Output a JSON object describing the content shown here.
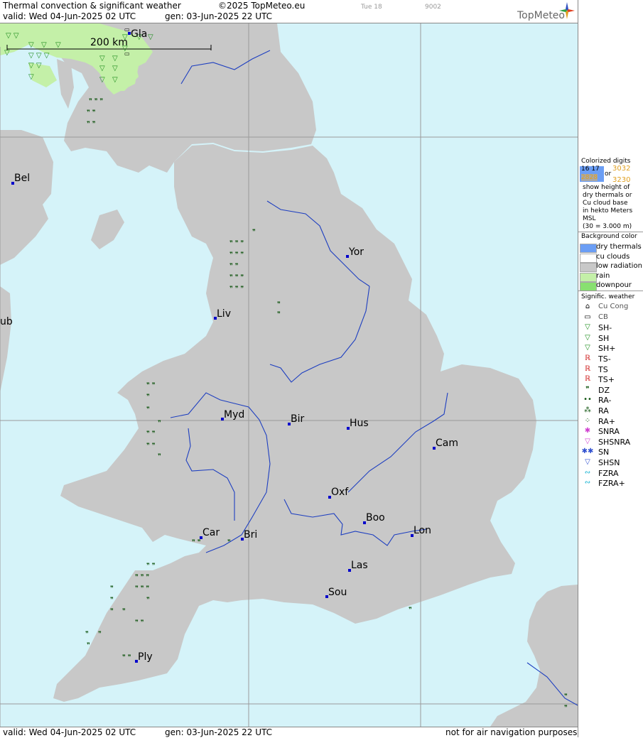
{
  "header": {
    "title": "Thermal convection & significant weather",
    "copyright": "©2025 TopMeteo.eu",
    "valid": "valid:  Wed  04-Jun-2025  02 UTC",
    "gen": "gen: 03-Jun-2025 22 UTC",
    "ghost_day": "Tue 18",
    "ghost_code": "9002",
    "brand": "TopMeteo"
  },
  "footer": {
    "valid": "valid:  Wed  04-Jun-2025  02 UTC",
    "gen": "gen: 03-Jun-2025 22 UTC",
    "disclaimer": "not for air navigation purposes"
  },
  "map": {
    "scale_label": "200 km",
    "cities": [
      {
        "name": "Gla"
      },
      {
        "name": "Bel"
      },
      {
        "name": "Yor"
      },
      {
        "name": "Liv"
      },
      {
        "name": "Myd"
      },
      {
        "name": "Bir"
      },
      {
        "name": "Hus"
      },
      {
        "name": "Cam"
      },
      {
        "name": "Oxf"
      },
      {
        "name": "Boo"
      },
      {
        "name": "Lon"
      },
      {
        "name": "Car"
      },
      {
        "name": "Bri"
      },
      {
        "name": "Las"
      },
      {
        "name": "Sou"
      },
      {
        "name": "Ply"
      },
      {
        "name": "ub"
      }
    ],
    "colors": {
      "sea": "#d5f3f9",
      "land": "#c8c8c8",
      "rain": "#c4f0a8",
      "river": "#1e3fc0"
    }
  },
  "legend": {
    "colorized_title": "Colorized digits",
    "digits": {
      "a": "16 17",
      "b": "3032",
      "c": "2828",
      "d": "3230",
      "or": "or"
    },
    "desc": [
      "show height of",
      "dry thermals or",
      "Cu cloud base",
      "in hekto Meters",
      "MSL",
      "(30 = 3.000 m)"
    ],
    "bg_title": "Background color",
    "bg_items": [
      {
        "label": "dry thermals",
        "color": "#6b9ef5"
      },
      {
        "label": "cu clouds",
        "color": "#ffffff"
      },
      {
        "label": "low radiation",
        "color": "#c8c8c8"
      },
      {
        "label": "rain",
        "color": "#c4f0a8"
      },
      {
        "label": "downpour",
        "color": "#88e070"
      }
    ],
    "wx_title": "Signific. weather",
    "wx_items": [
      {
        "label": "Cu Cong",
        "icon": "cu-cong-icon",
        "glyph": "⌂",
        "color": "#000000"
      },
      {
        "label": "CB",
        "icon": "cb-icon",
        "glyph": "▭",
        "color": "#000000"
      },
      {
        "label": "SH-",
        "icon": "shower-light-icon",
        "glyph": "▽",
        "color": "#1d8c1d"
      },
      {
        "label": "SH",
        "icon": "shower-icon",
        "glyph": "▽",
        "color": "#1d8c1d"
      },
      {
        "label": "SH+",
        "icon": "shower-heavy-icon",
        "glyph": "▽",
        "color": "#1d8c1d"
      },
      {
        "label": "TS-",
        "icon": "thunderstorm-light-icon",
        "glyph": "ℝ",
        "color": "#cc1111"
      },
      {
        "label": "TS",
        "icon": "thunderstorm-icon",
        "glyph": "ℝ",
        "color": "#cc1111"
      },
      {
        "label": "TS+",
        "icon": "thunderstorm-heavy-icon",
        "glyph": "ℝ",
        "color": "#cc1111"
      },
      {
        "label": "DZ",
        "icon": "drizzle-icon",
        "glyph": "❞",
        "color": "#115511"
      },
      {
        "label": "RA-",
        "icon": "rain-light-icon",
        "glyph": "••",
        "color": "#115511"
      },
      {
        "label": "RA",
        "icon": "rain-icon",
        "glyph": "⁂",
        "color": "#115511"
      },
      {
        "label": "RA+",
        "icon": "rain-heavy-icon",
        "glyph": "⁘",
        "color": "#115511"
      },
      {
        "label": "SNRA",
        "icon": "snow-rain-icon",
        "glyph": "✱",
        "color": "#d040d0"
      },
      {
        "label": "SHSNRA",
        "icon": "shower-snow-rain-icon",
        "glyph": "▽",
        "color": "#d040d0"
      },
      {
        "label": "SN",
        "icon": "snow-icon",
        "glyph": "✱✱",
        "color": "#3050d0"
      },
      {
        "label": "SHSN",
        "icon": "shower-snow-icon",
        "glyph": "▽",
        "color": "#3050d0"
      },
      {
        "label": "FZRA",
        "icon": "freezing-rain-icon",
        "glyph": "∾",
        "color": "#10b0d0"
      },
      {
        "label": "FZRA+",
        "icon": "freezing-rain-heavy-icon",
        "glyph": "∾",
        "color": "#10b0d0"
      }
    ]
  }
}
